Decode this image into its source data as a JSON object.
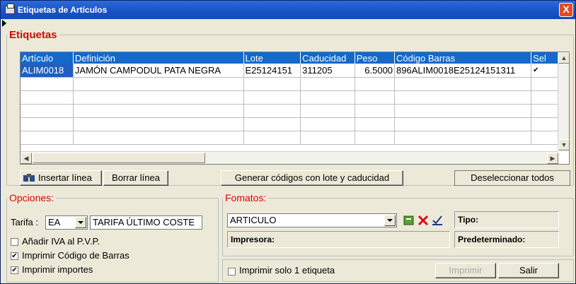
{
  "window": {
    "title": "Etiquetas de Artículos",
    "close_label": "X"
  },
  "etiquetas": {
    "legend": "Etiquetas",
    "columns": [
      "Artículo",
      "Definición",
      "Lote",
      "Caducidad",
      "Peso",
      "Código Barras",
      "Sel"
    ],
    "rows": [
      {
        "articulo": "ALIM0018",
        "definicion": "JAMÓN CAMPODUL PATA NEGRA",
        "lote": "E25124151",
        "caducidad": "311205",
        "peso": "6.5000",
        "codigo": "896ALIM0018E25124151311",
        "sel": "✔"
      }
    ]
  },
  "buttons": {
    "insertar": "Insertar línea",
    "borrar": "Borrar línea",
    "generar": "Generar códigos con lote y caducidad",
    "deseleccionar": "Deseleccionar todos"
  },
  "opciones": {
    "legend": "Opciones:",
    "tarifa_label": "Tarifa :",
    "tarifa_code": "EA",
    "tarifa_name": "TARIFA ÚLTIMO COSTE",
    "anadir_iva": "Añadir IVA al P.V.P.",
    "anadir_iva_checked": false,
    "imprimir_codigo": "Imprimir Código de Barras",
    "imprimir_codigo_checked": true,
    "imprimir_importes": "Imprimir importes",
    "imprimir_importes_checked": true
  },
  "formatos": {
    "legend": "Fomatos:",
    "value": "ARTICULO",
    "tipo": "Tipo:",
    "impresora": "Impresora:",
    "predeterminado": "Predeterminado:"
  },
  "bottom": {
    "solo1": "Imprimir solo 1 etiqueta",
    "solo1_checked": false,
    "imprimir": "Imprimir",
    "salir": "Salir"
  },
  "colors": {
    "title_bar": "#1b55c8",
    "legend_red": "#d20a0a",
    "grid_header": "#1469c9",
    "selection": "#1f5fc0"
  }
}
